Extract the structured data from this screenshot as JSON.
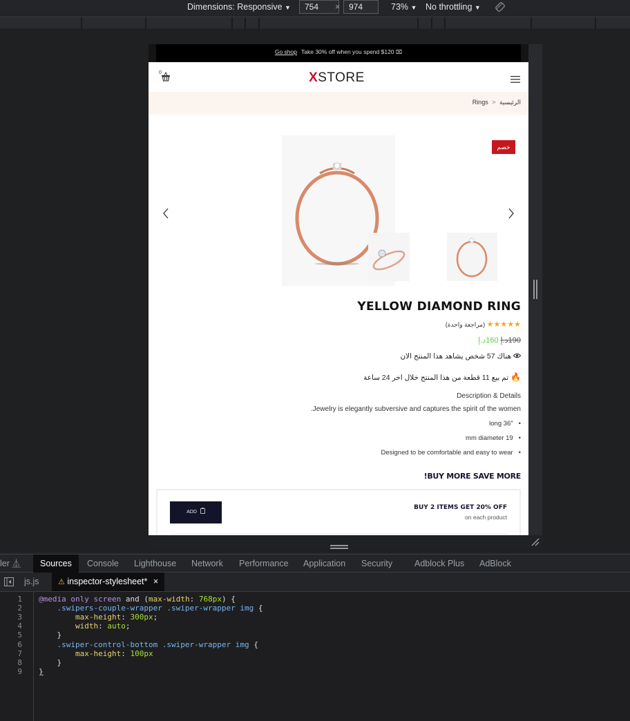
{
  "devtools": {
    "toolbar": {
      "dimensions_label": "Dimensions: Responsive",
      "width": "754",
      "height": "974",
      "times": "×",
      "zoom": "73%",
      "throttling": "No throttling",
      "caret": "▼"
    },
    "panel_tabs": [
      {
        "label": "ler"
      },
      {
        "label": "Sources",
        "active": true
      },
      {
        "label": "Console"
      },
      {
        "label": "Lighthouse"
      },
      {
        "label": "Network"
      },
      {
        "label": "Performance"
      },
      {
        "label": "Application"
      },
      {
        "label": "Security"
      },
      {
        "label": "Adblock Plus"
      },
      {
        "label": "AdBlock"
      }
    ],
    "file_tabs": [
      {
        "label": "js.js"
      },
      {
        "label": "inspector-stylesheet*",
        "active": true,
        "warning": true
      }
    ],
    "code_lines": [
      "1",
      "2",
      "3",
      "4",
      "5",
      "6",
      "7",
      "8",
      "9"
    ],
    "code": {
      "l1_at": "@media",
      "l1_only": "only",
      "l1_screen": "screen",
      "l1_rest": " and (",
      "l1_prop": "max-width",
      "l1_colon": ": ",
      "l1_val": "768px",
      "l1_end": ") {",
      "l2_sel": "    .swipers-couple-wrapper .swiper-wrapper img",
      "l2_end": " {",
      "l3_prop": "        max-height",
      "l3_val": "300px",
      "l4_prop": "        width",
      "l4_val": "auto",
      "l5": "    }",
      "l6_sel": "    .swiper-control-bottom .swiper-wrapper img",
      "l6_end": " {",
      "l7_prop": "        max-height",
      "l7_val": "100px",
      "l8": "    }",
      "l9": "}"
    }
  },
  "site": {
    "promo": {
      "link": "Go shop",
      "text": "Take 30% off when you spend $120"
    },
    "header": {
      "logo_x": "X",
      "logo_text": "STORE",
      "cart_count": "0"
    },
    "breadcrumb": {
      "home": "الرئيسية",
      "separator": "<",
      "current": "Rings"
    },
    "gallery": {
      "sale_badge": "خصم"
    },
    "product": {
      "title": "YELLOW DIAMOND RING",
      "rating": 5,
      "reviews": "(مراجعة واحدة)",
      "old_price": "190د.إ",
      "new_price": "160د.إ",
      "viewers": "هناك 57 شخص يشاهد هذا المنتج الان",
      "sold": "تم بيع 11 قطعة من هذا المنتج خلال اخر 24 ساعة",
      "description_title": "Description & Details",
      "description": "Jewelry is elegantly subversive and captures the spirit of the women.",
      "bullets": [
        "long 36″",
        "mm diameter 19",
        "Designed to be comfortable and easy to wear"
      ]
    },
    "offer": {
      "heading": "BUY MORE SAVE MORE!",
      "title": "BUY 2 ITEMS GET 20% OFF",
      "subtitle": "on each product",
      "add_label": "ADD"
    }
  }
}
